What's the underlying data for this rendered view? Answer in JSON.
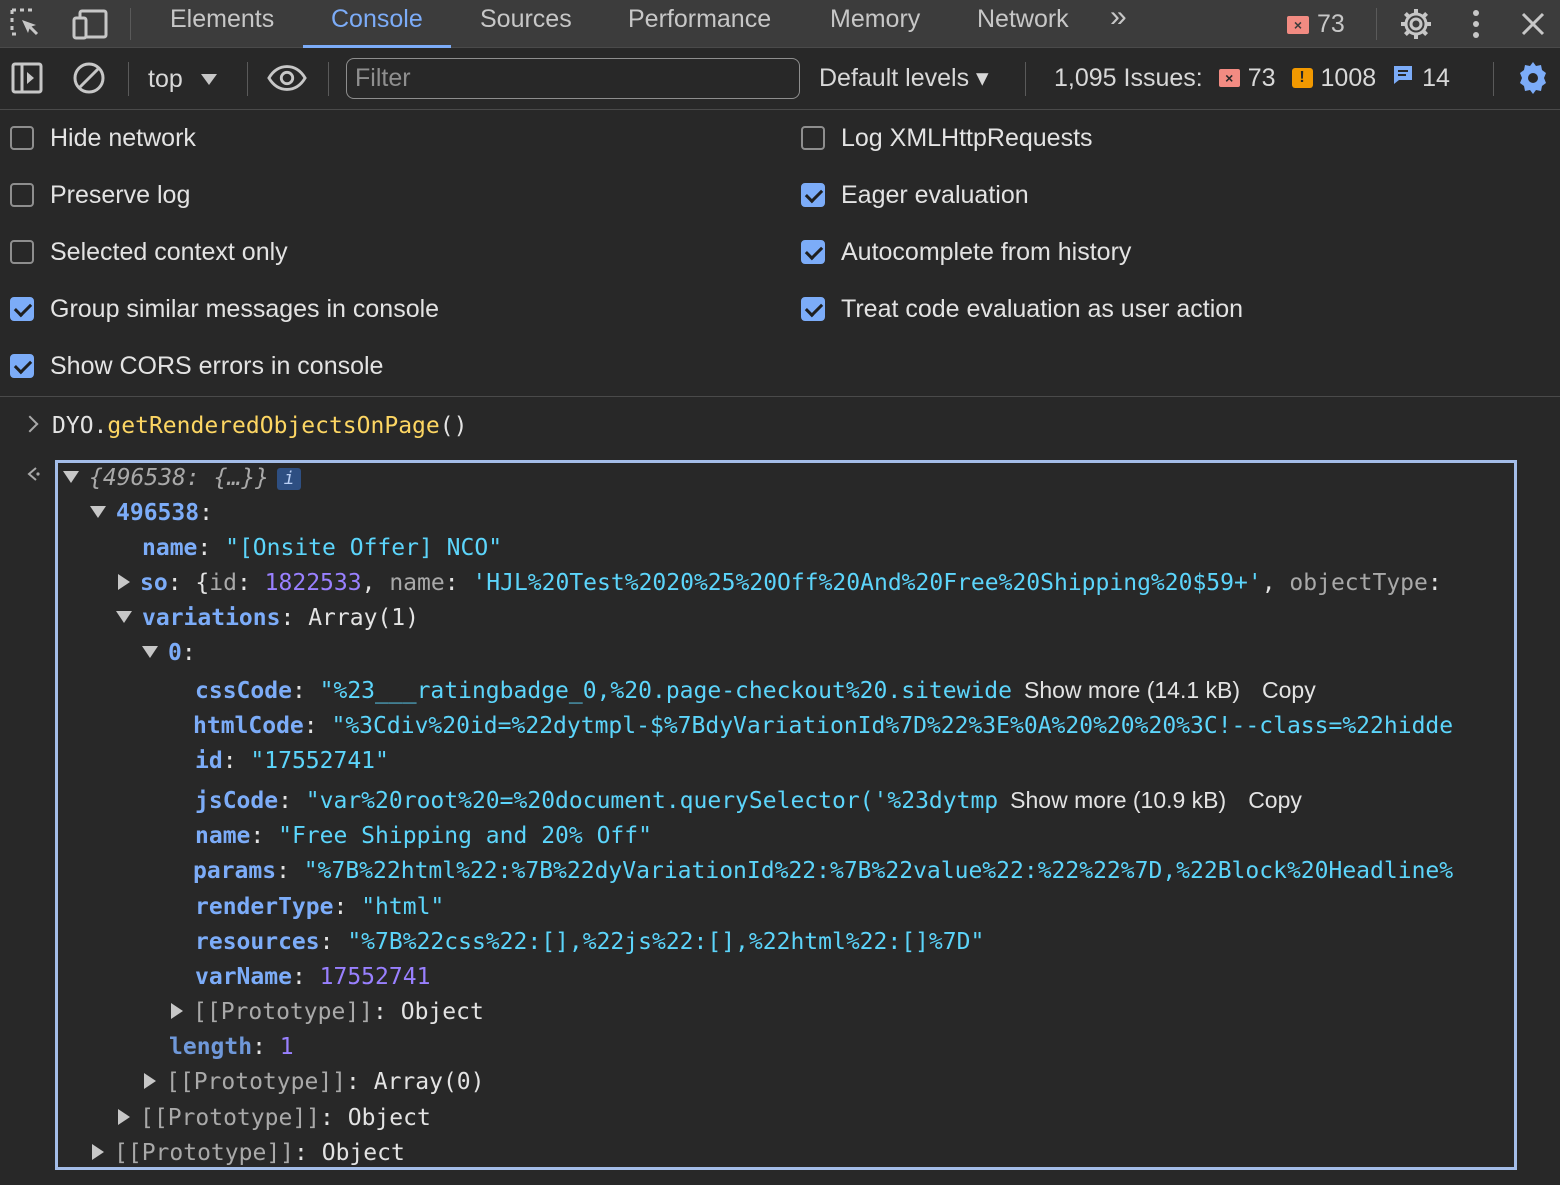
{
  "tabs": {
    "elements": "Elements",
    "console": "Console",
    "sources": "Sources",
    "performance": "Performance",
    "memory": "Memory",
    "network": "Network",
    "more": "»",
    "error_count": "73"
  },
  "toolbar": {
    "context": "top",
    "filter_placeholder": "Filter",
    "levels": "Default levels ▾",
    "issues_label": "1,095 Issues:",
    "issues_errors": "73",
    "issues_warnings": "1008",
    "issues_info": "14"
  },
  "settings": {
    "left": [
      {
        "label": "Hide network",
        "checked": false
      },
      {
        "label": "Preserve log",
        "checked": false
      },
      {
        "label": "Selected context only",
        "checked": false
      },
      {
        "label": "Group similar messages in console",
        "checked": true
      },
      {
        "label": "Show CORS errors in console",
        "checked": true
      }
    ],
    "right": [
      {
        "label": "Log XMLHttpRequests",
        "checked": false
      },
      {
        "label": "Eager evaluation",
        "checked": true
      },
      {
        "label": "Autocomplete from history",
        "checked": true
      },
      {
        "label": "Treat code evaluation as user action",
        "checked": true
      }
    ]
  },
  "console": {
    "input_obj": "DYO",
    "input_dot": ".",
    "input_method": "getRenderedObjectsOnPage",
    "input_parens": "()",
    "result_summary": "{496538: {…}}",
    "info_badge": "i",
    "key_496538": "496538",
    "name_key": "name",
    "name_val": "\"[Onsite Offer] NCO\"",
    "so_key": "so",
    "so_open": "{",
    "so_id_key": "id",
    "so_id_val": "1822533",
    "so_name_key": "name",
    "so_name_val": "'HJL%20Test%2020%25%20Off%20And%20Free%20Shipping%20$59+'",
    "so_objtype_key": "objectType",
    "variations_key": "variations",
    "variations_val": "Array(1)",
    "idx_0": "0",
    "css_key": "cssCode",
    "css_val": "\"%23___ratingbadge_0,%20.page-checkout%20.sitewide",
    "css_more": "Show more (14.1 kB)",
    "css_copy": "Copy",
    "html_key": "htmlCode",
    "html_val": "\"%3Cdiv%20id=%22dytmpl-$%7BdyVariationId%7D%22%3E%0A%20%20%20%3C!--class=%22hidde",
    "id_key": "id",
    "id_val": "\"17552741\"",
    "js_key": "jsCode",
    "js_val": "\"var%20root%20=%20document.querySelector('%23dytmp",
    "js_more": "Show more (10.9 kB)",
    "js_copy": "Copy",
    "vname_key": "name",
    "vname_val": "\"Free Shipping and 20% Off\"",
    "params_key": "params",
    "params_val": "\"%7B%22html%22:%7B%22dyVariationId%22:%7B%22value%22:%22%22%7D,%22Block%20Headline%",
    "render_key": "renderType",
    "render_val": "\"html\"",
    "res_key": "resources",
    "res_val": "\"%7B%22css%22:[],%22js%22:[],%22html%22:[]%7D\"",
    "varname_key": "varName",
    "varname_val": "17552741",
    "proto_key": "[[Prototype]]",
    "proto_obj": "Object",
    "length_key": "length",
    "length_val": "1",
    "proto_arr": "Array(0)"
  },
  "colors": {
    "accent": "#7cacf8",
    "error": "#f28b82",
    "warning": "#f29900",
    "string": "#5cd5fb",
    "number": "#9980ff"
  }
}
